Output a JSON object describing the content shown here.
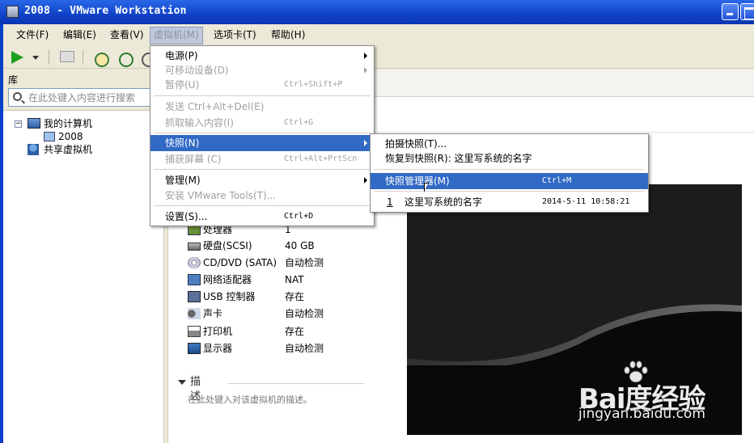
{
  "window": {
    "title": "2008 - VMware Workstation"
  },
  "menubar": [
    {
      "label": "文件(F)"
    },
    {
      "label": "编辑(E)"
    },
    {
      "label": "查看(V)"
    },
    {
      "label": "虚拟机(M)"
    },
    {
      "label": "选项卡(T)"
    },
    {
      "label": "帮助(H)"
    }
  ],
  "library": {
    "header": "库",
    "search_placeholder": "在此处键入内容进行搜索",
    "tree": {
      "my_computer": "我的计算机",
      "vm_2008": "2008",
      "shared_vms": "共享虚拟机"
    }
  },
  "hardware": [
    {
      "name": "处理器",
      "value": "1",
      "icon": "cpu-icon"
    },
    {
      "name": "硬盘(SCSI)",
      "value": "40 GB",
      "icon": "disk-icon"
    },
    {
      "name": "CD/DVD (SATA)",
      "value": "自动检测",
      "icon": "cd-icon"
    },
    {
      "name": "网络适配器",
      "value": "NAT",
      "icon": "nic-icon"
    },
    {
      "name": "USB 控制器",
      "value": "存在",
      "icon": "usb-icon"
    },
    {
      "name": "声卡",
      "value": "自动检测",
      "icon": "sound-icon"
    },
    {
      "name": "打印机",
      "value": "存在",
      "icon": "printer-icon"
    },
    {
      "name": "显示器",
      "value": "自动检测",
      "icon": "display-icon"
    }
  ],
  "description": {
    "title": "描述",
    "placeholder": "在此处键入对该虚拟机的描述。"
  },
  "vm_menu": {
    "items": [
      {
        "label": "电源(P)",
        "shortcut": "",
        "submenu": true,
        "disabled": false
      },
      {
        "label": "可移动设备(D)",
        "shortcut": "",
        "submenu": true,
        "disabled": true
      },
      {
        "label": "暂停(U)",
        "shortcut": "Ctrl+Shift+P",
        "submenu": false,
        "disabled": true
      },
      {
        "label": "发送 Ctrl+Alt+Del(E)",
        "shortcut": "",
        "submenu": false,
        "disabled": true
      },
      {
        "label": "抓取输入内容(I)",
        "shortcut": "Ctrl+G",
        "submenu": false,
        "disabled": true
      },
      {
        "label": "快照(N)",
        "shortcut": "",
        "submenu": true,
        "disabled": false,
        "highlighted": true
      },
      {
        "label": "捕获屏幕 (C)",
        "shortcut": "Ctrl+Alt+PrtScn",
        "submenu": false,
        "disabled": true
      },
      {
        "label": "管理(M)",
        "shortcut": "",
        "submenu": true,
        "disabled": false
      },
      {
        "label": "安装 VMware Tools(T)...",
        "shortcut": "",
        "submenu": false,
        "disabled": true
      },
      {
        "label": "设置(S)...",
        "shortcut": "Ctrl+D",
        "submenu": false,
        "disabled": false
      }
    ]
  },
  "snapshot_menu": {
    "take": "拍摄快照(T)...",
    "revert": "恢复到快照(R): 这里写系统的名字",
    "manager": "快照管理器(M)",
    "manager_shortcut": "Ctrl+M",
    "recent_index": "1",
    "recent_name": "这里写系统的名字",
    "recent_time": "2014-5-11 10:58:21"
  },
  "watermark": {
    "brand": "Bai度经验",
    "url": "jingyan.baidu.com"
  },
  "colors": {
    "titlebar": "#1042C8",
    "menu_highlight": "#316AC5",
    "play": "#1DA11D"
  }
}
